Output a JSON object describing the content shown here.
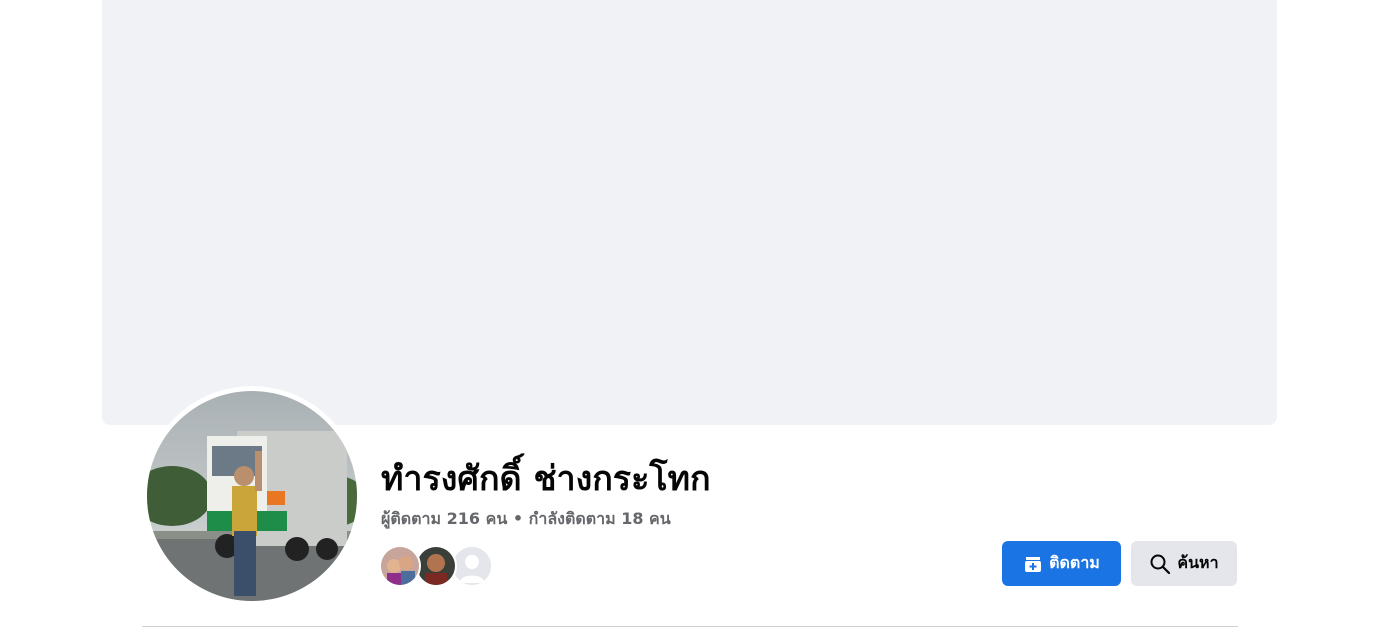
{
  "profile": {
    "name": "ทำรงศักดิ์ ช่างกระโทก",
    "followers_text": "ผู้ติดตาม 216 คน",
    "separator": "•",
    "following_text": "กำลังติดตาม 18 คน"
  },
  "actions": {
    "follow_label": "ติดตาม",
    "search_label": "ค้นหา"
  },
  "colors": {
    "cover_bg": "#f0f2f5",
    "primary_button": "#1b74e4",
    "secondary_button": "#e4e6eb",
    "secondary_text": "#65676b"
  },
  "icons": {
    "follow": "follow-plus-icon",
    "search": "search-icon"
  }
}
